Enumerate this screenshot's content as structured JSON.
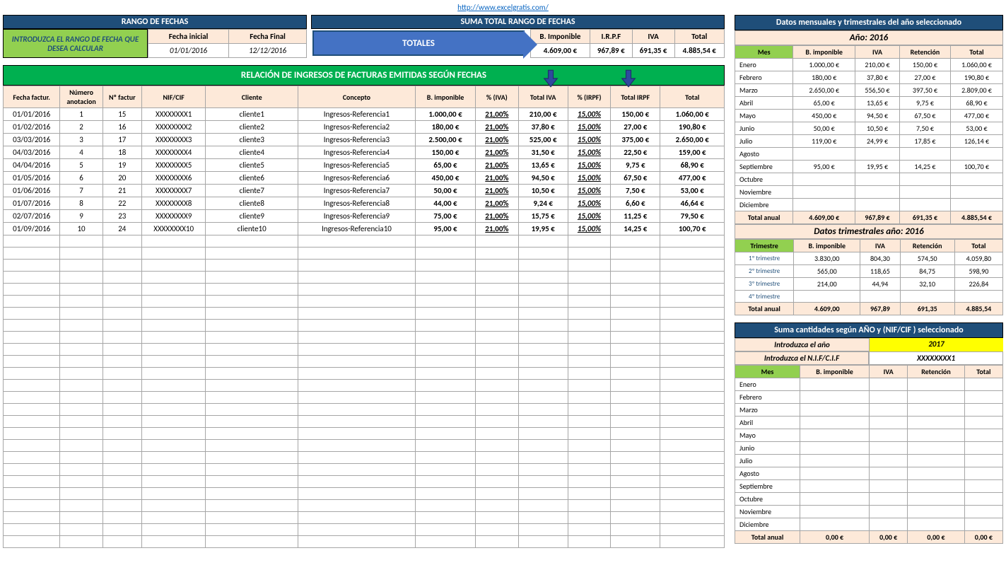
{
  "link": "http://www.excelgratis.com/",
  "headers": {
    "rango": "RANGO DE FECHAS",
    "suma": "SUMA TOTAL RANGO DE FECHAS",
    "introduzca": "INTRODUZCA EL RANGO DE FECHA QUE DESEA CALCULAR",
    "fecha_inicial_lbl": "Fecha inicial",
    "fecha_final_lbl": "Fecha Final",
    "fecha_inicial": "01/01/2016",
    "fecha_final": "12/12/2016",
    "totales": "TOTALES"
  },
  "sums": {
    "cols": [
      "B. Imponible",
      "I.R.P.F",
      "IVA",
      "Total"
    ],
    "vals": [
      "4.609,00 €",
      "967,89 €",
      "691,35 €",
      "4.885,54 €"
    ]
  },
  "banner": "RELACIÓN DE INGRESOS  DE FACTURAS EMITIDAS SEGÚN FECHAS",
  "main_cols": [
    "Fecha factur.",
    "Número anotacion",
    "Nº factur",
    "NIF/CIF",
    "Cliente",
    "Concepto",
    "B. imponible",
    "% (IVA)",
    "Total IVA",
    "% (IRPF)",
    "Total IRPF",
    "Total"
  ],
  "main_rows": [
    [
      "01/01/2016",
      "1",
      "15",
      "XXXXXXXX1",
      "cliente1",
      "Ingresos-Referencia1",
      "1.000,00 €",
      "21,00%",
      "210,00 €",
      "15,00%",
      "150,00 €",
      "1.060,00 €"
    ],
    [
      "01/02/2016",
      "2",
      "16",
      "XXXXXXXX2",
      "cliente2",
      "Ingresos-Referencia2",
      "180,00 €",
      "21,00%",
      "37,80 €",
      "15,00%",
      "27,00 €",
      "190,80 €"
    ],
    [
      "03/03/2016",
      "3",
      "17",
      "XXXXXXXX3",
      "cliente3",
      "Ingresos-Referencia3",
      "2.500,00 €",
      "21,00%",
      "525,00 €",
      "15,00%",
      "375,00 €",
      "2.650,00 €"
    ],
    [
      "04/03/2016",
      "4",
      "18",
      "XXXXXXXX4",
      "cliente4",
      "Ingresos-Referencia4",
      "150,00 €",
      "21,00%",
      "31,50 €",
      "15,00%",
      "22,50 €",
      "159,00 €"
    ],
    [
      "04/04/2016",
      "5",
      "19",
      "XXXXXXXX5",
      "cliente5",
      "Ingresos-Referencia5",
      "65,00 €",
      "21,00%",
      "13,65 €",
      "15,00%",
      "9,75 €",
      "68,90 €"
    ],
    [
      "01/05/2016",
      "6",
      "20",
      "XXXXXXXX6",
      "cliente6",
      "Ingresos-Referencia6",
      "450,00 €",
      "21,00%",
      "94,50 €",
      "15,00%",
      "67,50 €",
      "477,00 €"
    ],
    [
      "01/06/2016",
      "7",
      "21",
      "XXXXXXXX7",
      "cliente7",
      "Ingresos-Referencia7",
      "50,00 €",
      "21,00%",
      "10,50 €",
      "15,00%",
      "7,50 €",
      "53,00 €"
    ],
    [
      "01/07/2016",
      "8",
      "22",
      "XXXXXXXX8",
      "cliente8",
      "Ingresos-Referencia8",
      "44,00 €",
      "21,00%",
      "9,24 €",
      "15,00%",
      "6,60 €",
      "46,64 €"
    ],
    [
      "02/07/2016",
      "9",
      "23",
      "XXXXXXXX9",
      "cliente9",
      "Ingresos-Referencia9",
      "75,00 €",
      "21,00%",
      "15,75 €",
      "15,00%",
      "11,25 €",
      "79,50 €"
    ],
    [
      "01/09/2016",
      "10",
      "24",
      "XXXXXXXX10",
      "cliente10",
      "Ingresos-Referencia10",
      "95,00 €",
      "21,00%",
      "19,95 €",
      "15,00%",
      "14,25 €",
      "100,70 €"
    ]
  ],
  "right1": {
    "title": "Datos mensuales  y trimestrales del año seleccionado",
    "year": "Año:  2016",
    "cols": [
      "Mes",
      "B. imponible",
      "IVA",
      "Retención",
      "Total"
    ],
    "rows": [
      [
        "Enero",
        "1.000,00 €",
        "210,00 €",
        "150,00 €",
        "1.060,00 €"
      ],
      [
        "Febrero",
        "180,00 €",
        "37,80 €",
        "27,00 €",
        "190,80 €"
      ],
      [
        "Marzo",
        "2.650,00 €",
        "556,50 €",
        "397,50 €",
        "2.809,00 €"
      ],
      [
        "Abril",
        "65,00 €",
        "13,65 €",
        "9,75 €",
        "68,90 €"
      ],
      [
        "Mayo",
        "450,00 €",
        "94,50 €",
        "67,50 €",
        "477,00 €"
      ],
      [
        "Junio",
        "50,00 €",
        "10,50 €",
        "7,50 €",
        "53,00 €"
      ],
      [
        "Julio",
        "119,00 €",
        "24,99 €",
        "17,85 €",
        "126,14 €"
      ],
      [
        "Agosto",
        "",
        "",
        "",
        ""
      ],
      [
        "Septiembre",
        "95,00 €",
        "19,95 €",
        "14,25 €",
        "100,70 €"
      ],
      [
        "Octubre",
        "",
        "",
        "",
        ""
      ],
      [
        "Noviembre",
        "",
        "",
        "",
        ""
      ],
      [
        "Diciembre",
        "",
        "",
        "",
        ""
      ]
    ],
    "total": [
      "Total anual",
      "4.609,00 €",
      "967,89 €",
      "691,35 €",
      "4.885,54 €"
    ],
    "trim_title": "Datos trimestrales año: 2016",
    "trim_cols": [
      "Trimestre",
      "B. imponible",
      "IVA",
      "Retención",
      "Total"
    ],
    "trim_rows": [
      [
        "1º trimestre",
        "3.830,00",
        "804,30",
        "574,50",
        "4.059,80"
      ],
      [
        "2º trimestre",
        "565,00",
        "118,65",
        "84,75",
        "598,90"
      ],
      [
        "3º trimestre",
        "214,00",
        "44,94",
        "32,10",
        "226,84"
      ],
      [
        "4º trimestre",
        "",
        "",
        "",
        ""
      ]
    ],
    "trim_total": [
      "Total anual",
      "4.609,00",
      "967,89",
      "691,35",
      "4.885,54"
    ]
  },
  "right2": {
    "title": "Suma cantidades según  AÑO y  (NIF/CIF )  seleccionado",
    "intro_year_lbl": "Introduzca  el año",
    "intro_year_val": "2017",
    "intro_nif_lbl": "Introduzca el  N.I.F/C.I.F",
    "intro_nif_val": "XXXXXXXX1",
    "cols": [
      "Mes",
      "B. imponible",
      "IVA",
      "Retención",
      "Total"
    ],
    "months": [
      "Enero",
      "Febrero",
      "Marzo",
      "Abril",
      "Mayo",
      "Junio",
      "Julio",
      "Agosto",
      "Septiembre",
      "Octubre",
      "Noviembre",
      "Diciembre"
    ],
    "total": [
      "Total anual",
      "0,00 €",
      "0,00 €",
      "0,00 €",
      "0,00 €"
    ]
  }
}
